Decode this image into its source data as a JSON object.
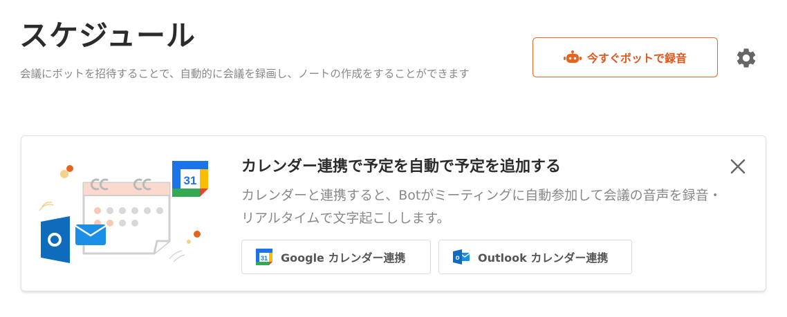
{
  "page": {
    "title": "スケジュール",
    "description": "会議にボットを招待することで、自動的に会議を録画し、ノートの作成をすることができます"
  },
  "header": {
    "record_button_label": "今すぐボットで録音",
    "record_icon": "robot-icon",
    "settings_icon": "gear-icon"
  },
  "card": {
    "title": "カレンダー連携で予定を自動で予定を追加する",
    "description": "カレンダーと連携すると、Botがミーティングに自動参加して会議の音声を録音・リアルタイムで文字起こしします。",
    "close_icon": "close-icon",
    "illustration_calendar_day": "31",
    "google_button_label": "Google カレンダー連携",
    "outlook_button_label": "Outlook カレンダー連携",
    "google_icon_day": "31",
    "outlook_icon_letter": "o"
  },
  "colors": {
    "accent": "#e8641e",
    "title_text": "#2b2b2b",
    "muted_text": "#888888",
    "outlook_blue": "#0f6cbd"
  }
}
